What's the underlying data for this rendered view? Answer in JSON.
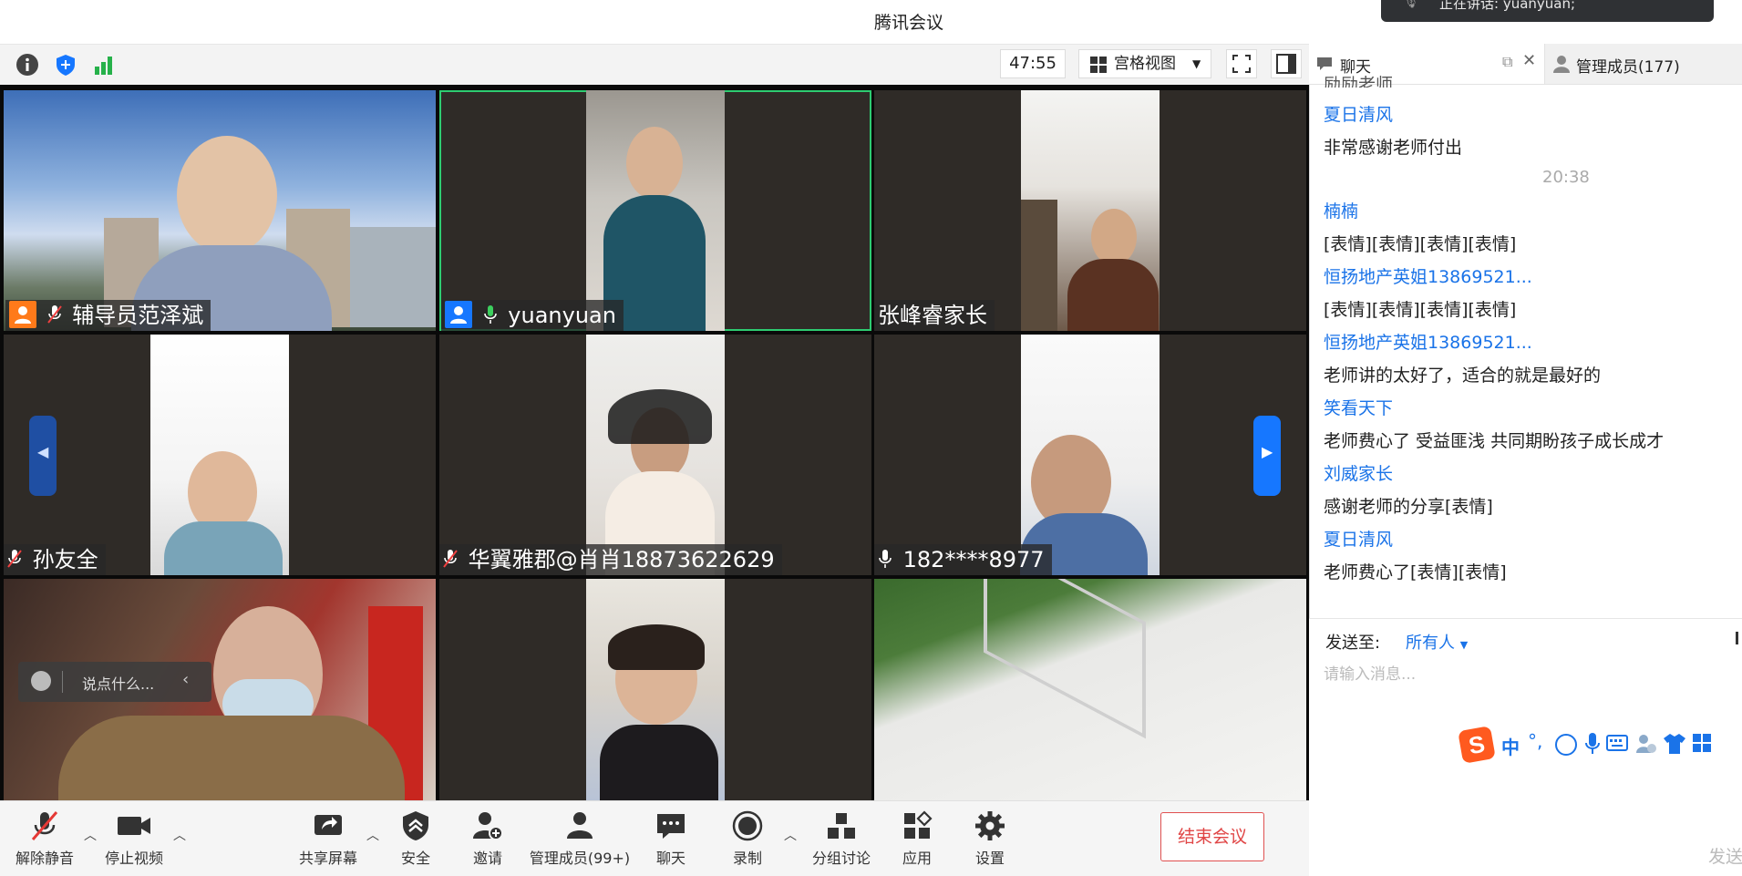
{
  "app": {
    "title": "腾讯会议"
  },
  "notice": {
    "text": "正在讲话: yuanyuan;"
  },
  "toolbar": {
    "timer": "47:55",
    "view_label": "宫格视图"
  },
  "participants": [
    {
      "name": "辅导员范泽斌",
      "badge": "host"
    },
    {
      "name": "yuanyuan",
      "badge": "cohost"
    },
    {
      "name": "张峰睿家长"
    },
    {
      "name": "孙友全"
    },
    {
      "name": "华翼雅郡@肖肖18873622629"
    },
    {
      "name": "182****8977"
    },
    {
      "name": ""
    },
    {
      "name": ""
    },
    {
      "name": ""
    }
  ],
  "float": {
    "say_placeholder": "说点什么..."
  },
  "bottom_toolbar": {
    "unmute": "解除静音",
    "stop_video": "停止视频",
    "share": "共享屏幕",
    "security": "安全",
    "invite": "邀请",
    "manage": "管理成员(99+)",
    "chat": "聊天",
    "record": "录制",
    "breakout": "分组讨论",
    "apps": "应用",
    "settings": "设置",
    "end": "结束会议"
  },
  "chat": {
    "tab_chat": "聊天",
    "tab_members": "管理成员(177)",
    "top_cut": "励励老师",
    "messages": [
      {
        "name": "夏日清风",
        "text": "非常感谢老师付出"
      },
      {
        "time": "20:38"
      },
      {
        "name": "楠楠",
        "text": "[表情][表情][表情][表情]"
      },
      {
        "name": "恒扬地产英姐13869521...",
        "text": "[表情][表情][表情][表情]"
      },
      {
        "name": "恒扬地产英姐13869521...",
        "text": "老师讲的太好了，适合的就是最好的"
      },
      {
        "name": "笑看天下",
        "text": "老师费心了 受益匪浅 共同期盼孩子成长成才"
      },
      {
        "name": "刘威家长",
        "text": "感谢老师的分享[表情]"
      },
      {
        "name": "夏日清风",
        "text": "老师费心了[表情][表情]"
      }
    ],
    "send_to_label": "发送至:",
    "send_to_value": "所有人",
    "input_placeholder": "请输入消息...",
    "send_button": "发送",
    "ime_text": "中"
  },
  "colors": {
    "accent": "#1a73e8",
    "end": "#e04545",
    "host_badge": "#ff7a1a",
    "cohost_badge": "#1677ff"
  }
}
